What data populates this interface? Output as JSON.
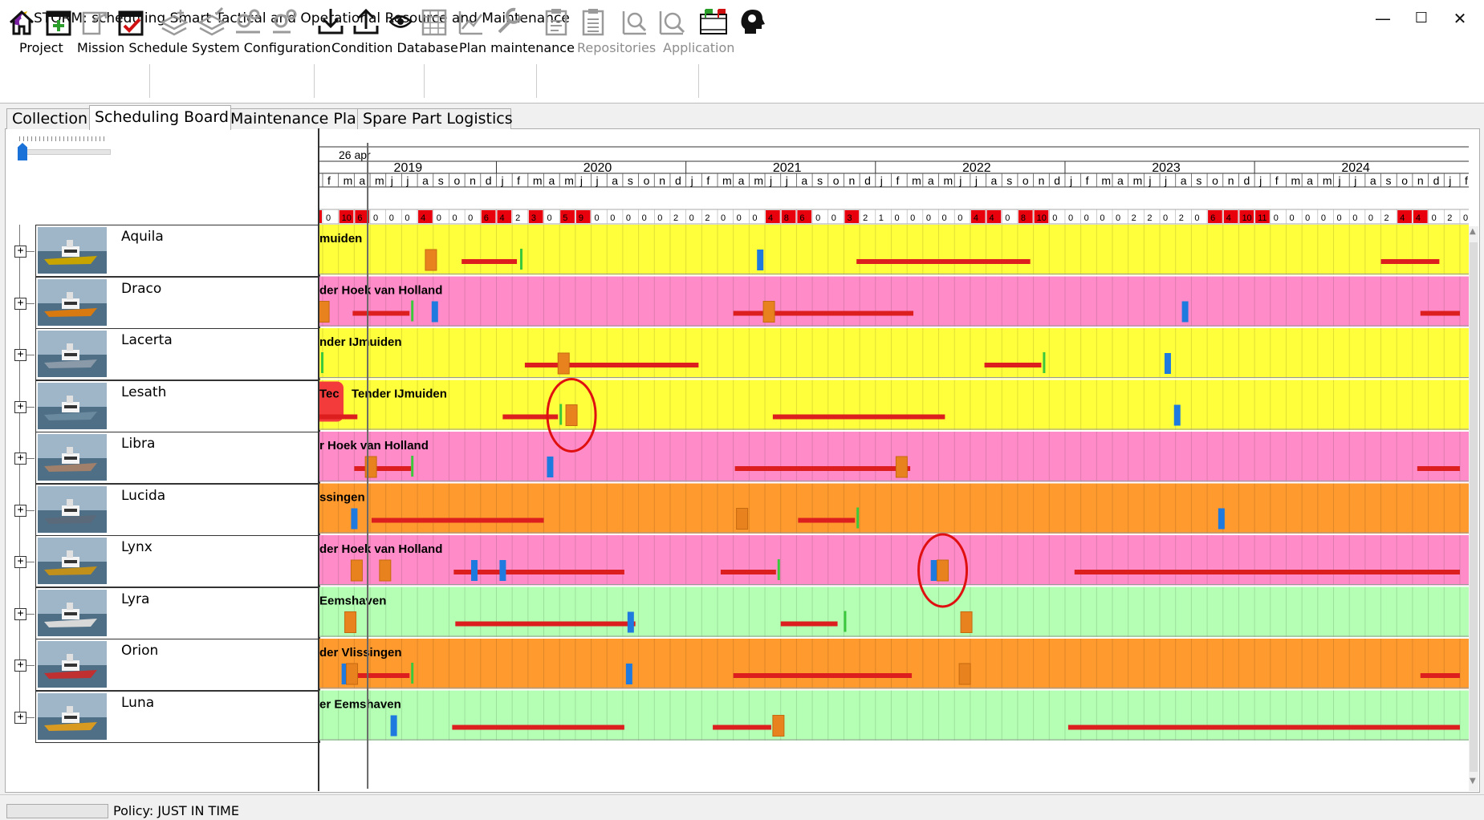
{
  "window": {
    "title": "STORM: scheduling Smart Tactical and Operational Resource and Maintenance",
    "minimize": "—",
    "maximize": "☐",
    "close": "✕"
  },
  "menu": [
    {
      "label": "Project",
      "enabled": true
    },
    {
      "label": "Mission Schedule",
      "enabled": true
    },
    {
      "label": "System Configuration",
      "enabled": true
    },
    {
      "label": "Condition Database",
      "enabled": true
    },
    {
      "label": "Plan maintenance",
      "enabled": true
    },
    {
      "label": "Repositories",
      "enabled": false
    },
    {
      "label": "Application",
      "enabled": false
    }
  ],
  "toolbar": [
    {
      "icon": "home-icon",
      "enabled": true
    },
    {
      "icon": "calendar-add-icon",
      "enabled": true
    },
    {
      "icon": "export-doc-icon",
      "enabled": false
    },
    {
      "icon": "calendar-check-icon",
      "enabled": true
    },
    {
      "icon": "layer-add-icon",
      "enabled": false
    },
    {
      "icon": "layer-edit-icon",
      "enabled": false
    },
    {
      "icon": "component-add-icon",
      "enabled": false
    },
    {
      "icon": "component-edit-icon",
      "enabled": false
    },
    {
      "icon": "download-icon",
      "enabled": true
    },
    {
      "icon": "upload-icon",
      "enabled": true
    },
    {
      "icon": "eye-icon",
      "enabled": true
    },
    {
      "icon": "grid-icon",
      "enabled": false
    },
    {
      "icon": "chart-edit-icon",
      "enabled": false
    },
    {
      "icon": "wrench-icon",
      "enabled": false
    },
    {
      "icon": "clipboard-add-icon",
      "enabled": false
    },
    {
      "icon": "clipboard-list-icon",
      "enabled": false
    },
    {
      "icon": "zoom-chart-icon",
      "enabled": false
    },
    {
      "icon": "zoom-search-icon",
      "enabled": false
    },
    {
      "icon": "film-flag-icon",
      "enabled": true
    },
    {
      "icon": "brain-head-icon",
      "enabled": true
    }
  ],
  "tabs": [
    {
      "label": "Collection",
      "active": false
    },
    {
      "label": "Scheduling Board",
      "active": true
    },
    {
      "label": "Maintenance Plans",
      "active": false
    },
    {
      "label": "Spare Part Logistics",
      "active": false
    }
  ],
  "timeline": {
    "cursor_label": "26 apr",
    "years": [
      "2019",
      "2020",
      "2021",
      "2022",
      "2023",
      "2024"
    ],
    "first_month_index": 1,
    "month_count": 72,
    "month_letters": [
      "j",
      "f",
      "m",
      "a",
      "m",
      "j",
      "j",
      "a",
      "s",
      "o",
      "n",
      "d"
    ],
    "counts": [
      "6",
      "0",
      "10",
      "6",
      "0",
      "0",
      "0",
      "4",
      "0",
      "0",
      "0",
      "6",
      "4",
      "2",
      "3",
      "0",
      "5",
      "9",
      "0",
      "0",
      "0",
      "0",
      "0",
      "2",
      "0",
      "2",
      "0",
      "0",
      "0",
      "4",
      "8",
      "6",
      "0",
      "0",
      "3",
      "2",
      "1",
      "0",
      "0",
      "0",
      "0",
      "0",
      "4",
      "4",
      "0",
      "8",
      "10",
      "0",
      "0",
      "0",
      "0",
      "0",
      "2",
      "2",
      "0",
      "2",
      "0",
      "6",
      "4",
      "10",
      "11",
      "0",
      "0",
      "0",
      "0",
      "0",
      "0",
      "0",
      "2",
      "4",
      "4",
      "0",
      "2",
      "0"
    ],
    "count_alert_color": "#e8000d"
  },
  "legend_colors": {
    "ijmuiden": "#ffff3c",
    "hoek": "#ff8cc8",
    "vlissingen": "#ff9a2e",
    "eemshaven": "#b4ffb4",
    "maintenance_bar": "#dc1e1e",
    "blue_event": "#1f7ae0",
    "orange_event": "#e8821e",
    "green_event": "#3cc83c",
    "highlight_circle": "#e01010"
  },
  "resources": [
    {
      "name": "Aquila",
      "location": "muiden",
      "color": "#ffff3c",
      "bars": [
        [
          8.8,
          12.3
        ],
        [
          33.8,
          44.8
        ],
        [
          67,
          70.7
        ]
      ],
      "blue": [
        [
          27.5
        ]
      ],
      "orange": [
        [
          6.5
        ]
      ],
      "green": [
        [
          12.5
        ]
      ]
    },
    {
      "name": "Draco",
      "location": "der Hoek van Holland",
      "color": "#ff8cc8",
      "bars": [
        [
          1.9,
          5.5
        ],
        [
          26,
          37.4
        ],
        [
          69.5,
          72
        ]
      ],
      "blue": [
        [
          6.9
        ],
        [
          54.4
        ]
      ],
      "orange": [
        [
          -0.3
        ],
        [
          27.9
        ]
      ],
      "green": [
        [
          5.6
        ]
      ]
    },
    {
      "name": "Lacerta",
      "location": "nder IJmuiden",
      "color": "#ffff3c",
      "bars": [
        [
          12.8,
          23.8
        ],
        [
          41.9,
          45.5
        ]
      ],
      "blue": [
        [
          53.3
        ]
      ],
      "orange": [
        [
          14.9
        ]
      ],
      "green": [
        [
          -0.1
        ],
        [
          45.6
        ]
      ]
    },
    {
      "name": "Lesath",
      "location": "Tender IJmuiden",
      "location_prefix": "Tec",
      "color": "#ffff3c",
      "bars": [
        [
          -1.5,
          2.2
        ],
        [
          11.4,
          14.9
        ],
        [
          28.5,
          39.4
        ]
      ],
      "blue": [
        [
          53.9
        ]
      ],
      "orange": [
        [
          15.4
        ]
      ],
      "green": [
        [
          15
        ]
      ]
    },
    {
      "name": "Libra",
      "location": "r Hoek van Holland",
      "color": "#ff8cc8",
      "bars": [
        [
          2,
          5.6
        ],
        [
          26.1,
          37.2
        ],
        [
          69.3,
          72
        ]
      ],
      "blue": [
        [
          14.2
        ]
      ],
      "orange": [
        [
          2.7
        ],
        [
          36.3
        ]
      ],
      "green": [
        [
          5.6
        ]
      ]
    },
    {
      "name": "Lucida",
      "location": "ssingen",
      "color": "#ff9a2e",
      "bars": [
        [
          3.1,
          14
        ],
        [
          30.1,
          33.7
        ]
      ],
      "blue": [
        [
          1.8
        ],
        [
          56.7
        ]
      ],
      "orange": [
        [
          26.2
        ]
      ],
      "green": [
        [
          33.8
        ]
      ]
    },
    {
      "name": "Lynx",
      "location": "der Hoek van Holland",
      "color": "#ff8cc8",
      "bars": [
        [
          8.3,
          19.1
        ],
        [
          25.2,
          28.7
        ],
        [
          47.6,
          72
        ]
      ],
      "blue": [
        [
          3.6
        ],
        [
          9.4
        ],
        [
          11.2
        ],
        [
          38.5
        ]
      ],
      "orange": [
        [
          1.8
        ],
        [
          3.6
        ],
        [
          38.9
        ]
      ],
      "green": [
        [
          28.8
        ]
      ]
    },
    {
      "name": "Lyra",
      "location": "Eemshaven",
      "color": "#b4ffb4",
      "bars": [
        [
          8.4,
          19.8
        ],
        [
          29,
          32.6
        ]
      ],
      "blue": [
        [
          19.3
        ]
      ],
      "orange": [
        [
          1.4
        ],
        [
          40.4
        ]
      ],
      "green": [
        [
          33
        ]
      ]
    },
    {
      "name": "Orion",
      "location": "der Vlissingen",
      "color": "#ff9a2e",
      "bars": [
        [
          1.9,
          5.5
        ],
        [
          26,
          37.3
        ],
        [
          69.5,
          72
        ]
      ],
      "blue": [
        [
          1.2
        ],
        [
          19.2
        ]
      ],
      "orange": [
        [
          1.5
        ],
        [
          40.3
        ]
      ],
      "green": [
        [
          5.6
        ]
      ]
    },
    {
      "name": "Luna",
      "location": "er Eemshaven",
      "color": "#b4ffb4",
      "bars": [
        [
          8.2,
          19.1
        ],
        [
          24.7,
          28.4
        ],
        [
          47.2,
          72
        ]
      ],
      "blue": [
        [
          4.3
        ]
      ],
      "orange": [
        [
          28.5
        ]
      ],
      "green": []
    }
  ],
  "highlights": [
    {
      "row": 3,
      "month": 15.4
    },
    {
      "row": 6,
      "month": 38.9
    }
  ],
  "status": {
    "policy": "Policy: JUST IN TIME"
  }
}
